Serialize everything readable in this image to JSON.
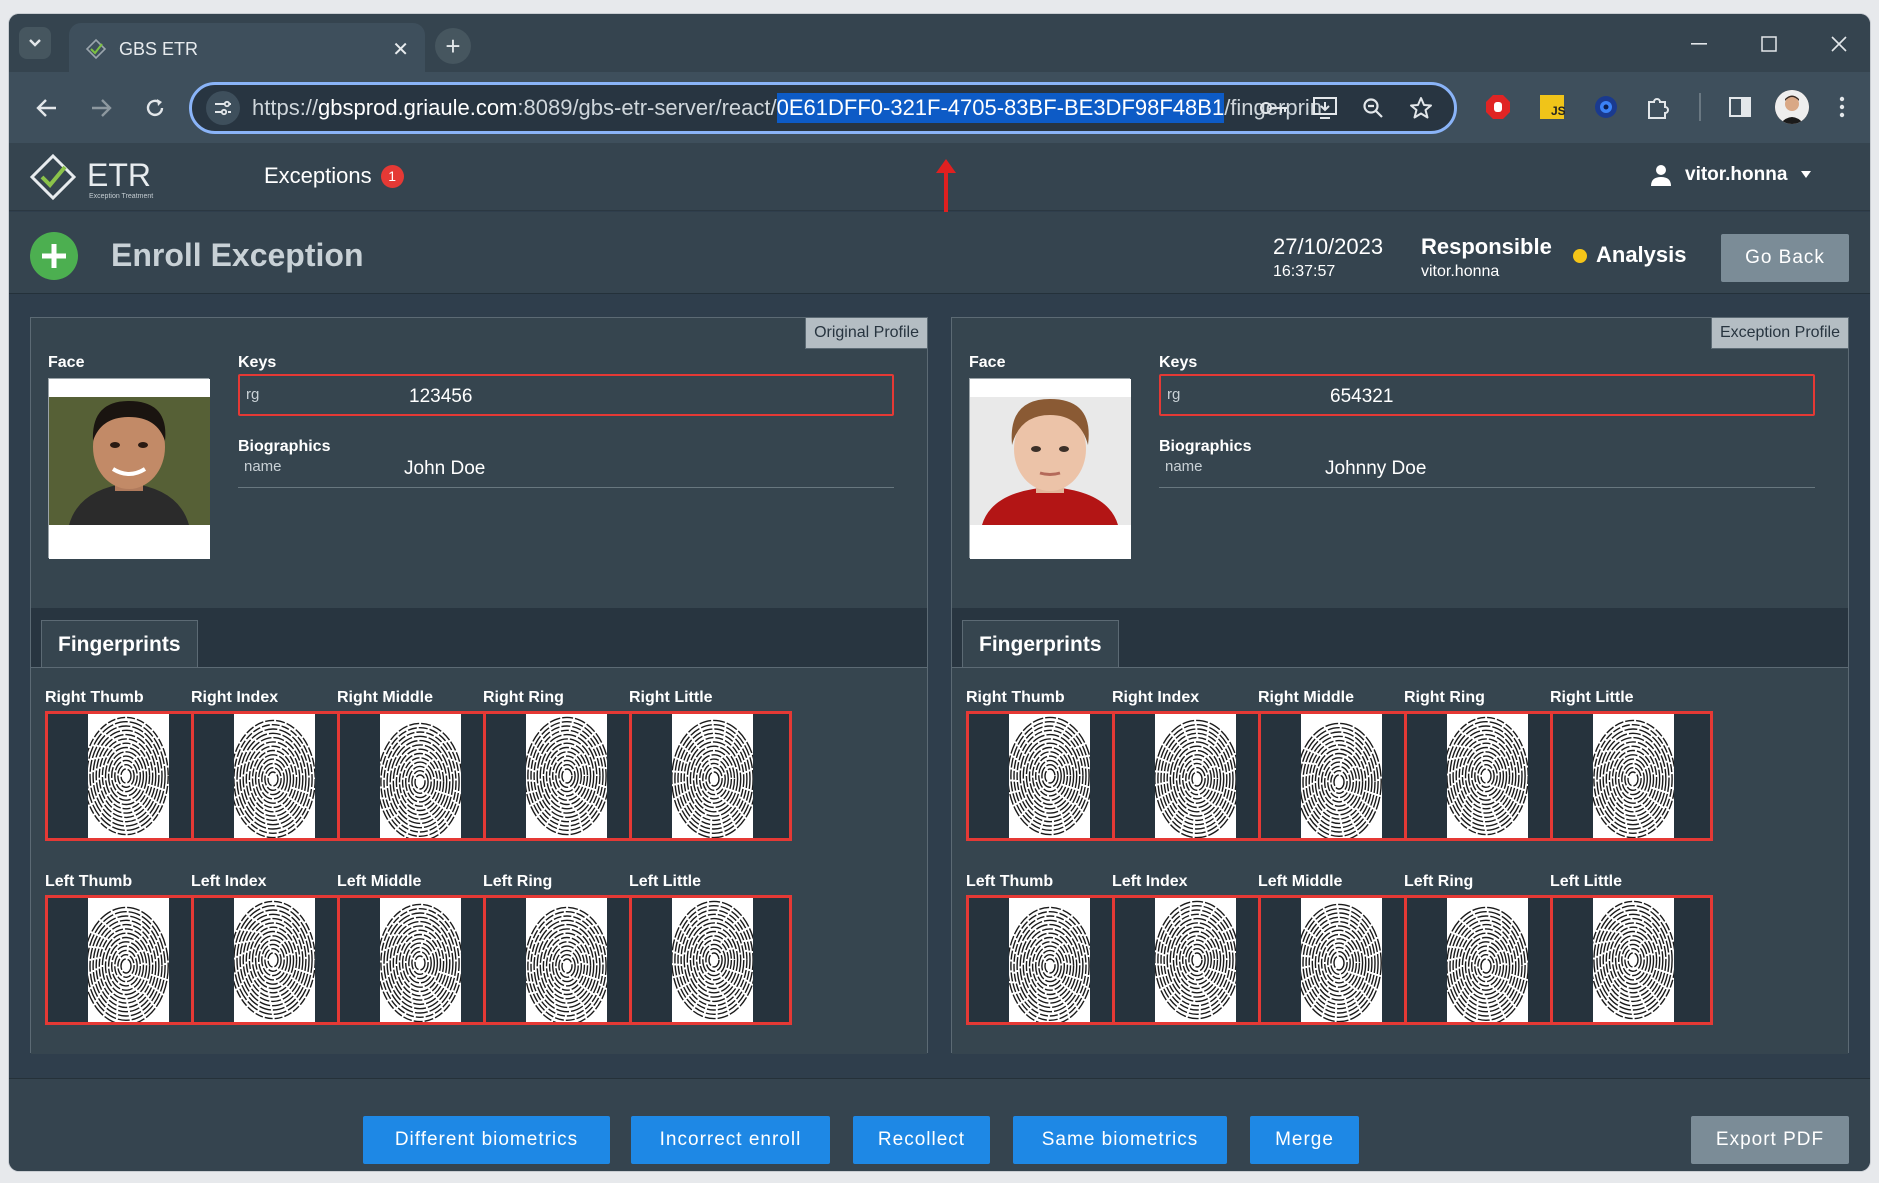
{
  "browser": {
    "tab_title": "GBS ETR",
    "url_scheme": "https://",
    "url_host": "gbsprod.griaule.com",
    "url_path_before": ":8089/gbs-etr-server/react/",
    "url_selected": "0E61DFF0-321F-4705-83BF-BE3DF98F48B1",
    "url_path_after": "/fingerprin"
  },
  "app": {
    "logo_text": "ETR",
    "logo_sub": "Exception Treatment",
    "nav_exceptions": "Exceptions",
    "exceptions_badge": "1",
    "user": "vitor.honna"
  },
  "header": {
    "title": "Enroll Exception",
    "date": "27/10/2023",
    "time": "16:37:57",
    "responsible_label": "Responsible",
    "responsible_user": "vitor.honna",
    "status": "Analysis",
    "status_color": "#f5c518",
    "go_back": "Go Back"
  },
  "labels": {
    "face": "Face",
    "keys": "Keys",
    "biographics": "Biographics",
    "fingerprints": "Fingerprints"
  },
  "profiles": [
    {
      "tag": "Original Profile",
      "key_name": "rg",
      "key_value": "123456",
      "bio_name": "name",
      "bio_value": "John Doe"
    },
    {
      "tag": "Exception Profile",
      "key_name": "rg",
      "key_value": "654321",
      "bio_name": "name",
      "bio_value": "Johnny Doe"
    }
  ],
  "fingers": [
    "Right Thumb",
    "Right Index",
    "Right Middle",
    "Right Ring",
    "Right Little",
    "Left Thumb",
    "Left Index",
    "Left Middle",
    "Left Ring",
    "Left Little"
  ],
  "footer": {
    "buttons": [
      "Different biometrics",
      "Incorrect enroll",
      "Recollect",
      "Same biometrics",
      "Merge"
    ],
    "export": "Export PDF"
  },
  "colors": {
    "accent_blue": "#1e88e5",
    "alert_red": "#e53935",
    "add_green": "#4caf50"
  }
}
